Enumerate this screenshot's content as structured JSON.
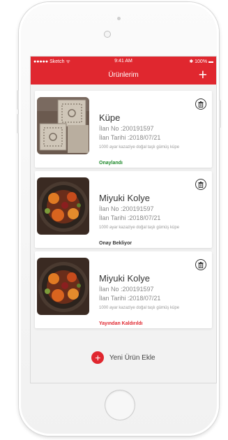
{
  "statusbar": {
    "carrier": "Sketch",
    "time": "9:41 AM",
    "battery": "100%"
  },
  "navbar": {
    "title": "Ürünlerim",
    "add_glyph": "+"
  },
  "products": [
    {
      "name": "Küpe",
      "ilan_no": "İlan No :200191597",
      "ilan_tarihi": "İlan Tarihi :2018/07/21",
      "description": "1000 ayar kazaziye doğal taşlı gümüş küpe",
      "status": "Onaylandı",
      "status_color": "#1f8a2b",
      "image": "crochet-squares"
    },
    {
      "name": "Miyuki Kolye",
      "ilan_no": "İlan No :200191597",
      "ilan_tarihi": "İlan Tarihi :2018/07/21",
      "description": "1000 ayar kazaziye doğal taşlı gümüş küpe",
      "status": "Onay Bekliyor",
      "status_color": "#333333",
      "image": "food-plate"
    },
    {
      "name": "Miyuki Kolye",
      "ilan_no": "İlan No :200191597",
      "ilan_tarihi": "İlan Tarihi :2018/07/21",
      "description": "1000 ayar kazaziye doğal taşlı gümüş küpe",
      "status": "Yayından Kaldırıldı",
      "status_color": "#e0272f",
      "image": "food-plate"
    }
  ],
  "add_button": {
    "glyph": "+",
    "label": "Yeni Ürün Ekle"
  },
  "accent_color": "#e0272f"
}
